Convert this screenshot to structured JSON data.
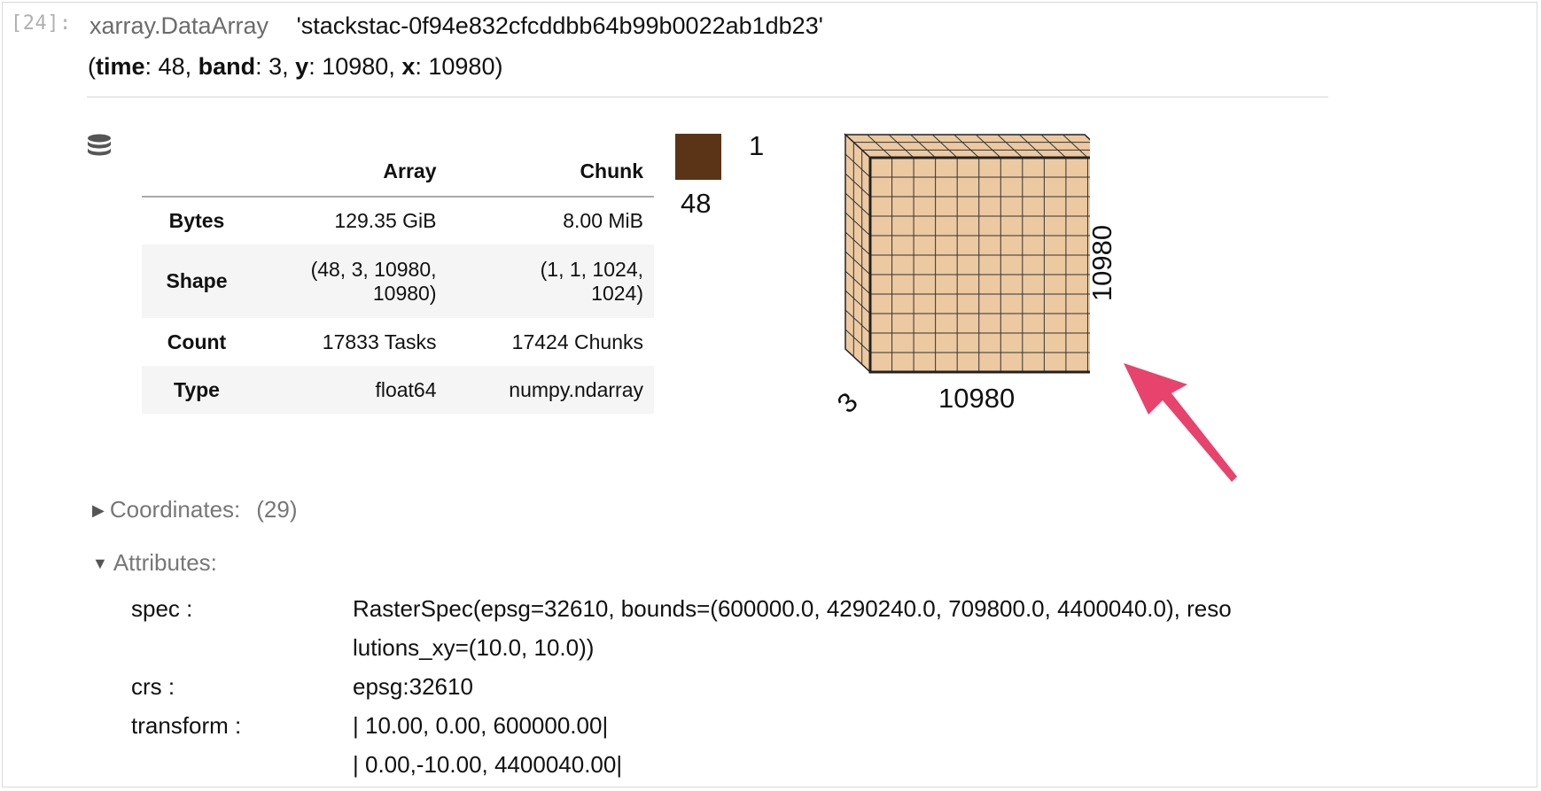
{
  "cell": {
    "prompt": "[24]:"
  },
  "header": {
    "type": "xarray.DataArray",
    "name": "'stackstac-0f94e832cfcddbb64b99b0022ab1db23'",
    "dims": [
      {
        "name": "time",
        "size": "48"
      },
      {
        "name": "band",
        "size": "3"
      },
      {
        "name": "y",
        "size": "10980"
      },
      {
        "name": "x",
        "size": "10980"
      }
    ]
  },
  "icons": {
    "database": "database-icon",
    "arrow": "pink-arrow-annotation"
  },
  "table": {
    "columns": [
      "",
      "Array",
      "Chunk"
    ],
    "rows": [
      {
        "label": "Bytes",
        "array": "129.35 GiB",
        "chunk": "8.00 MiB"
      },
      {
        "label": "Shape",
        "array_l1": "(48, 3, 10980,",
        "array_l2": "10980)",
        "chunk_l1": "(1, 1, 1024,",
        "chunk_l2": "1024)"
      },
      {
        "label": "Count",
        "array": "17833 Tasks",
        "chunk": "17424 Chunks"
      },
      {
        "label": "Type",
        "array": "float64",
        "chunk": "numpy.ndarray"
      }
    ]
  },
  "legend": {
    "top": "1",
    "bottom": "48",
    "color": "#5b3418"
  },
  "cube": {
    "x_label": "10980",
    "y_label": "10980",
    "band_label": "3",
    "fill": "#ecc9a1",
    "grid_count": 11
  },
  "arrow_color": "#e8436c",
  "sections": {
    "coordinates": {
      "label": "Coordinates:",
      "count": "(29)",
      "expanded": false
    },
    "attributes": {
      "label": "Attributes:",
      "expanded": true
    }
  },
  "attributes": [
    {
      "key": "spec :",
      "lines": [
        "RasterSpec(epsg=32610, bounds=(600000.0, 4290240.0, 709800.0, 4400040.0), reso",
        "lutions_xy=(10.0, 10.0))"
      ]
    },
    {
      "key": "crs :",
      "lines": [
        "epsg:32610"
      ]
    },
    {
      "key": "transform :",
      "lines": [
        "| 10.00, 0.00, 600000.00|",
        "| 0.00,-10.00, 4400040.00|"
      ]
    }
  ]
}
